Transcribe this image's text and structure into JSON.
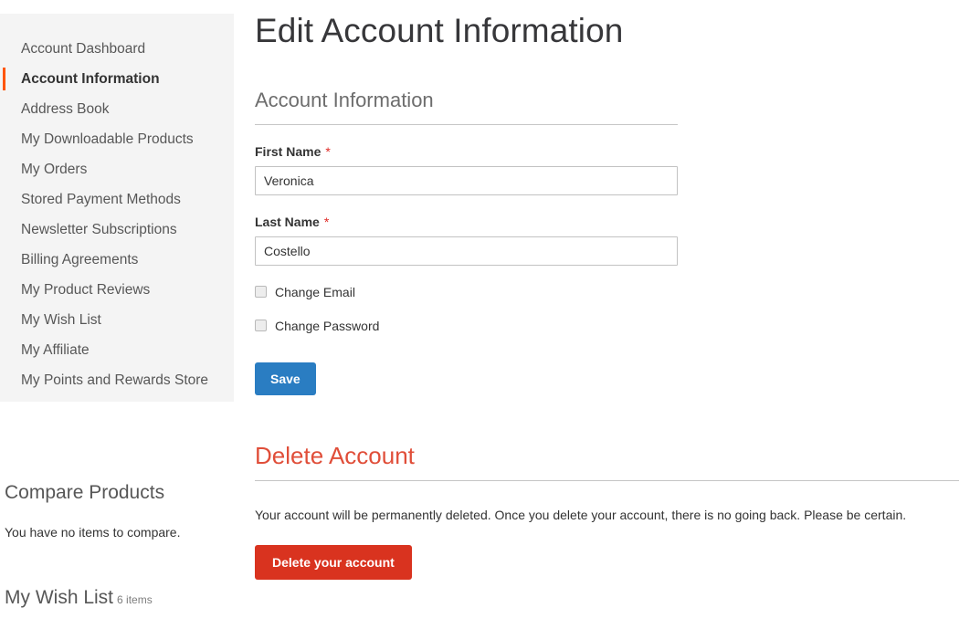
{
  "sidebar": {
    "nav_items": [
      {
        "label": "Account Dashboard",
        "current": false
      },
      {
        "label": "Account Information",
        "current": true
      },
      {
        "label": "Address Book",
        "current": false
      },
      {
        "label": "My Downloadable Products",
        "current": false
      },
      {
        "label": "My Orders",
        "current": false
      },
      {
        "label": "Stored Payment Methods",
        "current": false
      },
      {
        "label": "Newsletter Subscriptions",
        "current": false
      },
      {
        "label": "Billing Agreements",
        "current": false
      },
      {
        "label": "My Product Reviews",
        "current": false
      },
      {
        "label": "My Wish List",
        "current": false
      },
      {
        "label": "My Affiliate",
        "current": false
      },
      {
        "label": "My Points and Rewards Store",
        "current": false
      }
    ],
    "compare_products": {
      "title": "Compare Products",
      "empty_text": "You have no items to compare."
    },
    "wishlist": {
      "title": "My Wish List",
      "counter": "6 items"
    },
    "active_marker_color": "#ff5501"
  },
  "main": {
    "page_title": "Edit Account Information",
    "account_information": {
      "legend": "Account Information",
      "first_name": {
        "label": "First Name",
        "required_mark": "*",
        "value": "Veronica",
        "placeholder": ""
      },
      "last_name": {
        "label": "Last Name",
        "required_mark": "*",
        "value": "Costello",
        "placeholder": ""
      },
      "change_email": {
        "label": "Change Email",
        "checked": false
      },
      "change_password": {
        "label": "Change Password",
        "checked": false
      },
      "save_label": "Save",
      "save_color": "#2a7dc2"
    },
    "delete_account": {
      "title": "Delete Account",
      "title_color": "#e04e39",
      "note": "Your account will be permanently deleted. Once you delete your account, there is no going back. Please be certain.",
      "button_label": "Delete your account",
      "button_color": "#d9331f"
    }
  }
}
